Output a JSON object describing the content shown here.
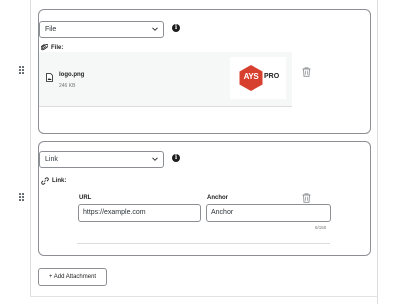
{
  "attachments": [
    {
      "type_select": {
        "value": "File"
      },
      "info_icon": "info-icon",
      "section_label": "File:",
      "file": {
        "name": "logo.png",
        "size": "246 KB"
      },
      "preview": {
        "logo_text": "AYS",
        "logo_suffix": "PRO"
      }
    },
    {
      "type_select": {
        "value": "Link"
      },
      "info_icon": "info-icon",
      "section_label": "Link:",
      "url_label": "URL",
      "url_value": "https://example.com",
      "anchor_label": "Anchor",
      "anchor_value": "Anchor",
      "anchor_counter": "6/150"
    }
  ],
  "add_button_label": "+ Add Attachment",
  "colors": {
    "border": "#8c8f94",
    "logo_red": "#d7402e",
    "panel_bg": "#f6f7f7"
  }
}
